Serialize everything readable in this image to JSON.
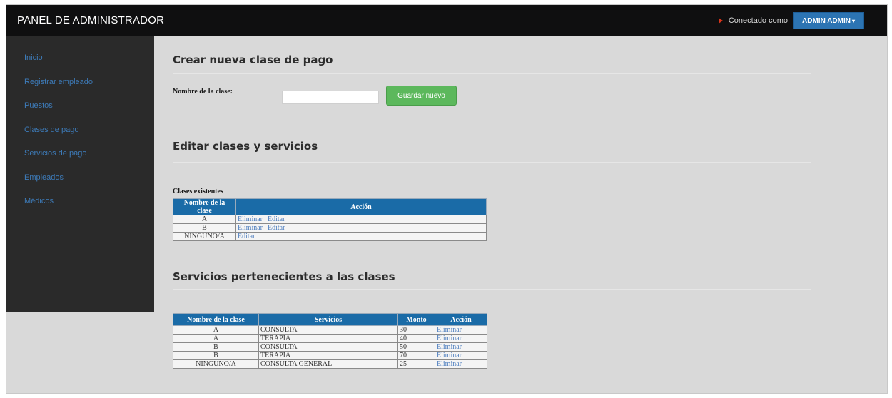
{
  "header": {
    "brand": "PANEL DE ADMINISTRADOR",
    "connected_as": "Conectado como",
    "user_menu_label": "ADMIN ADMIN",
    "caret": "▾"
  },
  "sidebar": {
    "items": [
      {
        "label": "Inicio"
      },
      {
        "label": "Registrar empleado"
      },
      {
        "label": "Puestos"
      },
      {
        "label": "Clases de pago"
      },
      {
        "label": "Servicios de pago"
      },
      {
        "label": "Empleados"
      },
      {
        "label": "Médicos"
      }
    ]
  },
  "create_section": {
    "title": "Crear nueva clase de pago",
    "field_label": "Nombre de la clase:",
    "field_value": "",
    "save_label": "Guardar nuevo"
  },
  "edit_section": {
    "title": "Editar clases y servicios",
    "existing_label": "Clases existentes",
    "columns": [
      "Nombre de la clase",
      "Acción"
    ],
    "rows": [
      {
        "name": "A",
        "delete": "Eliminar",
        "sep": "|",
        "edit": "Editar"
      },
      {
        "name": "B",
        "delete": "Eliminar",
        "sep": "|",
        "edit": "Editar"
      },
      {
        "name": "NINGUNO/A",
        "edit": "Editar"
      }
    ]
  },
  "services_section": {
    "title": "Servicios pertenecientes a las clases",
    "columns": [
      "Nombre de la clase",
      "Servicios",
      "Monto",
      "Acción"
    ],
    "rows": [
      {
        "class": "A",
        "service": "CONSULTA",
        "amount": "30",
        "action": "Eliminar"
      },
      {
        "class": "A",
        "service": "TERAPIA",
        "amount": "40",
        "action": "Eliminar"
      },
      {
        "class": "B",
        "service": "CONSULTA",
        "amount": "50",
        "action": "Eliminar"
      },
      {
        "class": "B",
        "service": "TERAPIA",
        "amount": "70",
        "action": "Eliminar"
      },
      {
        "class": "NINGUNO/A",
        "service": "CONSULTA GENERAL",
        "amount": "25",
        "action": "Eliminar"
      }
    ]
  },
  "colors": {
    "navbar": "#0f0f10",
    "sidebar": "#2a2a2a",
    "table_header": "#1a6ba7",
    "save_button": "#5cb85c",
    "link": "#4f7fbf"
  }
}
